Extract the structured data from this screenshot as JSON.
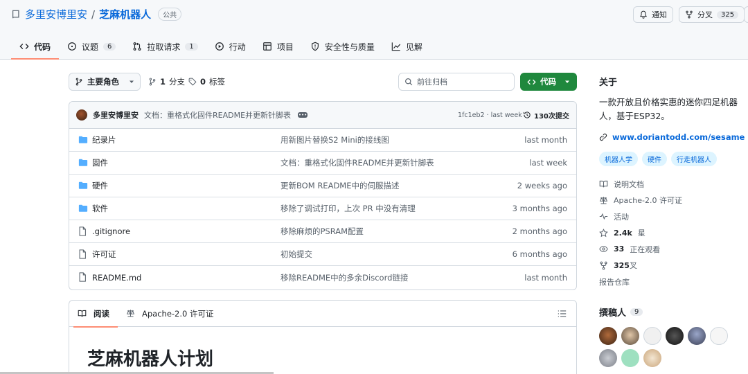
{
  "repo": {
    "owner": "多里安博里安",
    "separator": "/",
    "name": "芝麻机器人",
    "visibility": "公共"
  },
  "header_actions": {
    "notify_label": "通知",
    "fork_label": "分叉",
    "fork_count": "325"
  },
  "tabs": [
    {
      "label": "代码",
      "icon": "code-icon"
    },
    {
      "label": "议题",
      "count": "6",
      "icon": "issue-icon"
    },
    {
      "label": "拉取请求",
      "count": "1",
      "icon": "pull-request-icon"
    },
    {
      "label": "行动",
      "icon": "play-icon"
    },
    {
      "label": "项目",
      "icon": "table-icon"
    },
    {
      "label": "安全性与质量",
      "icon": "shield-icon"
    },
    {
      "label": "见解",
      "icon": "graph-icon"
    }
  ],
  "toolbar": {
    "branch_label": "主要角色",
    "branches_count": "1",
    "branches_label": "分支",
    "tags_count": "0",
    "tags_label": "标签",
    "search_placeholder": "前往归档",
    "code_button_label": "代码"
  },
  "latest_commit": {
    "author": "多里安博里安",
    "message": "文档：重格式化固件README并更新针脚表",
    "hash_time": "1fc1eb2 · last week",
    "commit_count_label": "130次提交"
  },
  "files": [
    {
      "type": "folder",
      "name": "纪录片",
      "message": "用新图片替换S2 Mini的接线图",
      "date": "last month"
    },
    {
      "type": "folder",
      "name": "固件",
      "message": "文档：重格式化固件README并更新针脚表",
      "date": "last week"
    },
    {
      "type": "folder",
      "name": "硬件",
      "message": "更新BOM README中的伺服描述",
      "date": "2 weeks ago"
    },
    {
      "type": "folder",
      "name": "软件",
      "message": "移除了调试打印，上次 PR 中没有清理",
      "date": "3 months ago"
    },
    {
      "type": "file",
      "name": ".gitignore",
      "message": "移除麻烦的PSRAM配置",
      "date": "2 months ago"
    },
    {
      "type": "file",
      "name": "许可证",
      "message": "初始提交",
      "date": "6 months ago"
    },
    {
      "type": "file",
      "name": "README.md",
      "message": "移除README中的多余Discord链接",
      "date": "last month"
    }
  ],
  "readme": {
    "tab_read": "阅读",
    "tab_license": "Apache-2.0 许可证",
    "heading": "芝麻机器人计划"
  },
  "about": {
    "title": "关于",
    "description": "一款开放且价格实惠的迷你四足机器人，基于ESP32。",
    "website": "www.doriantodd.com/sesame",
    "topics": [
      "机器人学",
      "硬件",
      "行走机器人"
    ],
    "items": [
      {
        "icon": "book-icon",
        "label": "说明文档"
      },
      {
        "icon": "law-icon",
        "label": "Apache-2.0 许可证"
      },
      {
        "icon": "pulse-icon",
        "label": "活动"
      },
      {
        "icon": "star-icon",
        "count": "2.4k",
        "label": "星"
      },
      {
        "icon": "eye-icon",
        "count": "33",
        "label": "正在观看"
      },
      {
        "icon": "fork-icon",
        "count": "325",
        "label": "叉"
      },
      {
        "icon": "",
        "label": "报告仓库"
      }
    ]
  },
  "contributors": {
    "title": "撰稿人",
    "count": "9"
  }
}
